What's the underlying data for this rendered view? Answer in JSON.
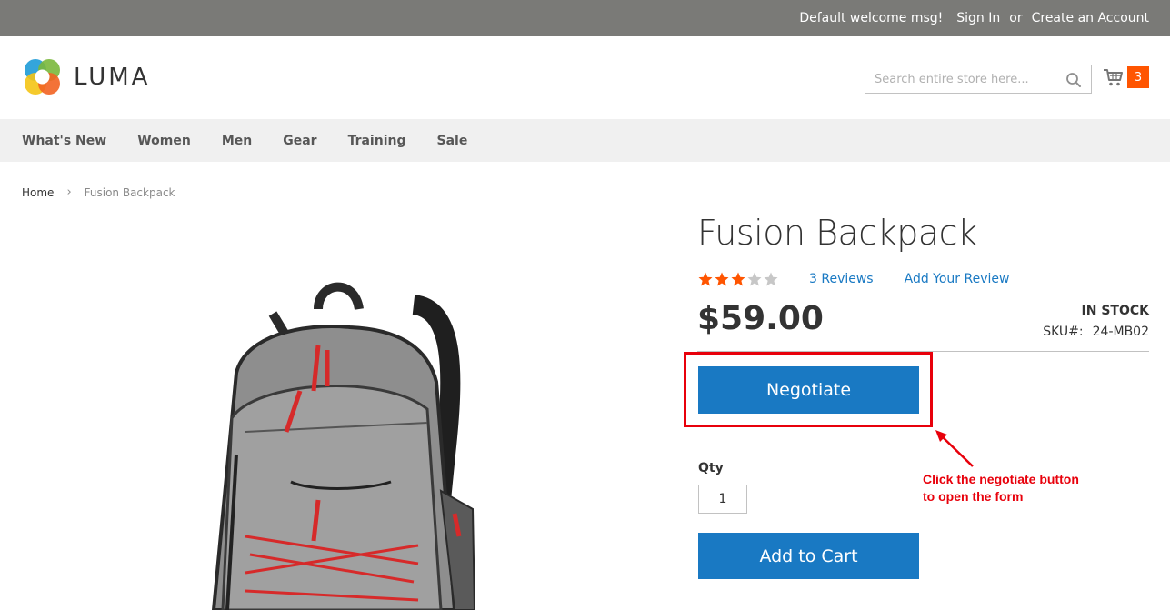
{
  "top_bar": {
    "welcome": "Default welcome msg!",
    "sign_in": "Sign In",
    "or": "or",
    "create_account": "Create an Account"
  },
  "header": {
    "logo_text": "LUMA",
    "search_placeholder": "Search entire store here...",
    "cart_count": "3",
    "icons": [
      "luma-logo-icon",
      "search-icon",
      "cart-icon"
    ]
  },
  "nav": {
    "items": [
      "What's New",
      "Women",
      "Men",
      "Gear",
      "Training",
      "Sale"
    ]
  },
  "breadcrumb": {
    "home": "Home",
    "current": "Fusion Backpack"
  },
  "product": {
    "title": "Fusion Backpack",
    "rating_stars": 3,
    "rating_max": 5,
    "reviews_link": "3 Reviews",
    "add_review_link": "Add Your Review",
    "price": "$59.00",
    "stock": "IN STOCK",
    "sku_label": "SKU#:",
    "sku_value": "24-MB02",
    "negotiate_label": "Negotiate",
    "qty_label": "Qty",
    "qty_value": "1",
    "add_to_cart_label": "Add to Cart"
  },
  "annotation": {
    "line1": "Click the negotiate button",
    "line2": "to open the form"
  },
  "colors": {
    "accent_blue": "#1979c3",
    "cart_badge": "#ff5501",
    "star_filled": "#ff5501",
    "star_empty": "#c7c7c7",
    "annotation_red": "#e8000b",
    "top_bar": "#7a7a77"
  }
}
